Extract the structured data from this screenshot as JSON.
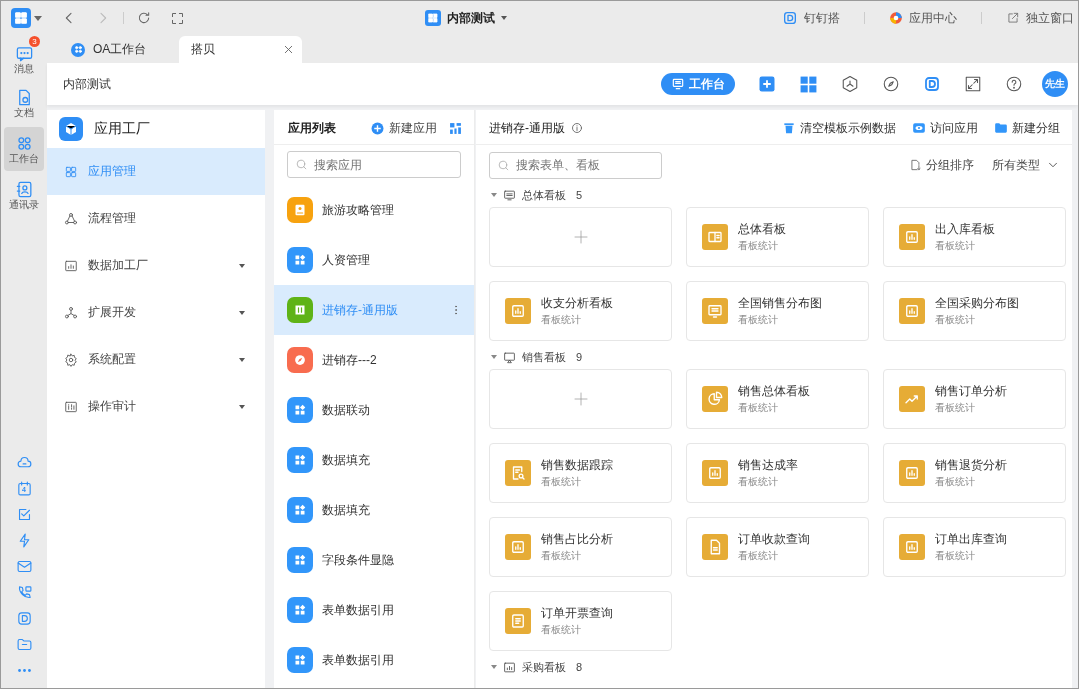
{
  "rail": {
    "items": [
      {
        "kind": "chat",
        "label": "消息",
        "badge": "3",
        "selected": false
      },
      {
        "kind": "doc",
        "label": "文档",
        "selected": false
      },
      {
        "kind": "workbench",
        "label": "工作台",
        "selected": true
      },
      {
        "kind": "contacts",
        "label": "通讯录",
        "selected": false
      }
    ],
    "tools": [
      {
        "kind": "cloud"
      },
      {
        "kind": "calendar",
        "text": "4"
      },
      {
        "kind": "task"
      },
      {
        "kind": "bolt"
      },
      {
        "kind": "mail"
      },
      {
        "kind": "phone"
      },
      {
        "kind": "dingtalk"
      },
      {
        "kind": "folder"
      },
      {
        "kind": "more"
      }
    ]
  },
  "titlebar": {
    "title": "内部测试",
    "links": [
      {
        "kind": "dingtalk",
        "label": "钉钉搭"
      },
      {
        "kind": "app-center",
        "label": "应用中心"
      },
      {
        "kind": "popout",
        "label": "独立窗口"
      }
    ]
  },
  "tabs": [
    {
      "label": "OA工作台",
      "selected": false,
      "closable": false
    },
    {
      "label": "搭贝",
      "selected": true,
      "closable": true
    }
  ],
  "toolbar": {
    "breadcrumb": "内部测试",
    "workbench": "工作台",
    "avatar": "先生"
  },
  "sidebar": {
    "title": "应用工厂",
    "items": [
      {
        "kind": "grid",
        "label": "应用管理",
        "selected": true,
        "expandable": false
      },
      {
        "kind": "flow",
        "label": "流程管理",
        "selected": false,
        "expandable": false
      },
      {
        "kind": "chart",
        "label": "数据加工厂",
        "selected": false,
        "expandable": true
      },
      {
        "kind": "network",
        "label": "扩展开发",
        "selected": false,
        "expandable": true
      },
      {
        "kind": "gear",
        "label": "系统配置",
        "selected": false,
        "expandable": true
      },
      {
        "kind": "audit",
        "label": "操作审计",
        "selected": false,
        "expandable": true
      }
    ]
  },
  "app_list": {
    "title": "应用列表",
    "new_label": "新建应用",
    "placeholder": "搜索应用",
    "items": [
      {
        "name": "旅游攻略管理",
        "kind": "contact",
        "color": "#f7a20f",
        "selected": false
      },
      {
        "name": "人资管理",
        "kind": "grid",
        "color": "#3296fa",
        "selected": false
      },
      {
        "name": "进销存-通用版",
        "kind": "book",
        "color": "#5fb317",
        "selected": true
      },
      {
        "name": "进销存---2",
        "kind": "compass",
        "color": "#f86c4f",
        "selected": false
      },
      {
        "name": "数据联动",
        "kind": "grid",
        "color": "#3296fa",
        "selected": false
      },
      {
        "name": "数据填充",
        "kind": "grid",
        "color": "#3296fa",
        "selected": false
      },
      {
        "name": "数据填充",
        "kind": "grid",
        "color": "#3296fa",
        "selected": false
      },
      {
        "name": "字段条件显隐",
        "kind": "grid",
        "color": "#3296fa",
        "selected": false
      },
      {
        "name": "表单数据引用",
        "kind": "grid",
        "color": "#3296fa",
        "selected": false
      },
      {
        "name": "表单数据引用",
        "kind": "grid",
        "color": "#3296fa",
        "selected": false
      }
    ]
  },
  "main": {
    "title": "进销存-通用版",
    "actions": [
      {
        "kind": "trash",
        "label": "清空模板示例数据"
      },
      {
        "kind": "eye",
        "label": "访问应用"
      },
      {
        "kind": "folder",
        "label": "新建分组"
      }
    ],
    "placeholder": "搜索表单、看板",
    "sort_label": "分组排序",
    "type_filter": "所有类型",
    "groups": [
      {
        "name": "总体看板",
        "count": "5",
        "kind": "monitor",
        "expanded": true,
        "cards": [
          {
            "kind": "add"
          },
          {
            "kind": "layout",
            "title": "总体看板",
            "subtitle": "看板统计"
          },
          {
            "kind": "bar",
            "title": "出入库看板",
            "subtitle": "看板统计"
          },
          {
            "kind": "bar",
            "title": "收支分析看板",
            "subtitle": "看板统计"
          },
          {
            "kind": "screen",
            "title": "全国销售分布图",
            "subtitle": "看板统计"
          },
          {
            "kind": "bar",
            "title": "全国采购分布图",
            "subtitle": "看板统计"
          }
        ]
      },
      {
        "name": "销售看板",
        "count": "9",
        "kind": "display",
        "expanded": true,
        "cards": [
          {
            "kind": "add"
          },
          {
            "kind": "pie",
            "title": "销售总体看板",
            "subtitle": "看板统计"
          },
          {
            "kind": "trend",
            "title": "销售订单分析",
            "subtitle": "看板统计"
          },
          {
            "kind": "search-doc",
            "title": "销售数据跟踪",
            "subtitle": "看板统计"
          },
          {
            "kind": "bar",
            "title": "销售达成率",
            "subtitle": "看板统计"
          },
          {
            "kind": "bar",
            "title": "销售退货分析",
            "subtitle": "看板统计"
          },
          {
            "kind": "bar",
            "title": "销售占比分析",
            "subtitle": "看板统计"
          },
          {
            "kind": "doc",
            "title": "订单收款查询",
            "subtitle": "看板统计"
          },
          {
            "kind": "bar",
            "title": "订单出库查询",
            "subtitle": "看板统计"
          },
          {
            "kind": "list",
            "title": "订单开票查询",
            "subtitle": "看板统计"
          }
        ]
      },
      {
        "name": "采购看板",
        "count": "8",
        "kind": "chart",
        "expanded": true
      }
    ]
  }
}
